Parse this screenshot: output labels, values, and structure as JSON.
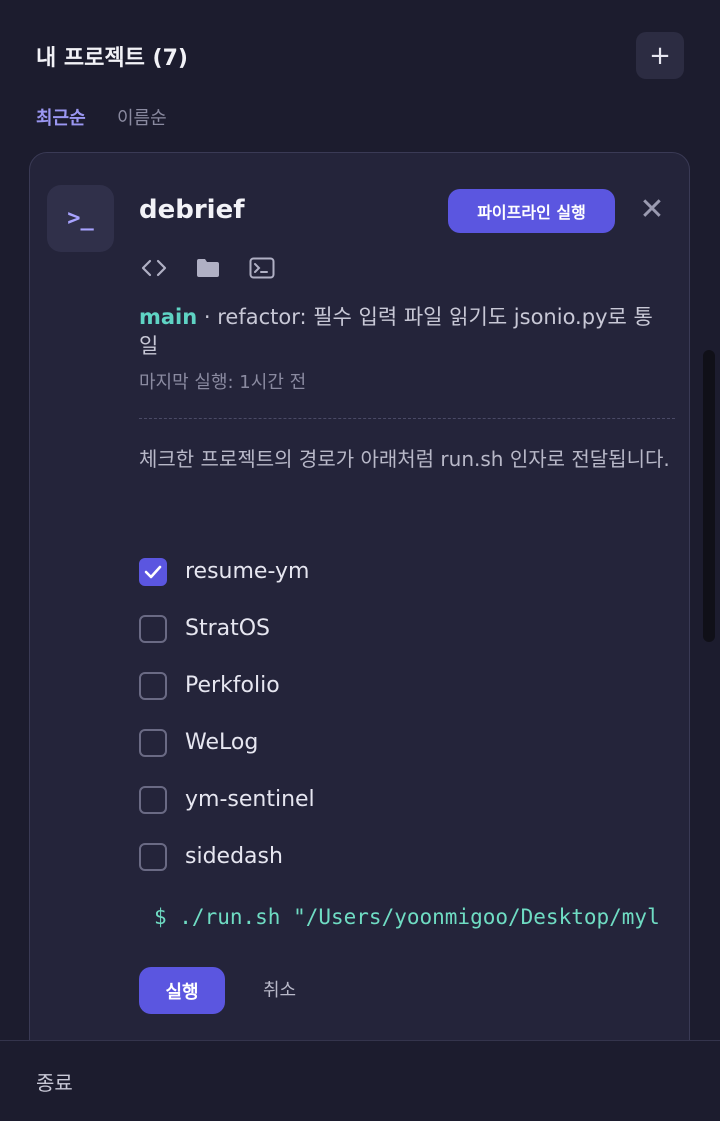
{
  "header": {
    "title": "내 프로젝트 (7)",
    "add_label": "+"
  },
  "sort": {
    "recent": "최근순",
    "name": "이름순"
  },
  "project": {
    "icon_text": ">_",
    "name": "debrief",
    "run_pipeline_label": "파이프라인 실행",
    "close_label": "✕",
    "branch": "main",
    "separator": " · ",
    "commit_message": "refactor: 필수 입력 파일 읽기도 jsonio.py로 통일",
    "last_run": "마지막 실행: 1시간 전",
    "description": "체크한 프로젝트의 경로가 아래처럼 run.sh 인자로 전달됩니다."
  },
  "checklist": [
    {
      "label": "resume-ym",
      "checked": true
    },
    {
      "label": "StratOS",
      "checked": false
    },
    {
      "label": "Perkfolio",
      "checked": false
    },
    {
      "label": "WeLog",
      "checked": false
    },
    {
      "label": "ym-sentinel",
      "checked": false
    },
    {
      "label": "sidedash",
      "checked": false
    }
  ],
  "command": "$ ./run.sh \"/Users/yoonmigoo/Desktop/myl",
  "actions": {
    "run_label": "실행",
    "cancel_label": "취소"
  },
  "footer": {
    "quit_label": "종료"
  },
  "icons": [
    "code-icon",
    "folder-icon",
    "terminal-icon",
    "plus-icon",
    "close-icon",
    "check-icon"
  ],
  "colors": {
    "accent": "#5b56e0",
    "branch": "#5fd3c4",
    "command": "#6fdcc3",
    "background": "#1c1c2e",
    "card": "#24243a"
  }
}
